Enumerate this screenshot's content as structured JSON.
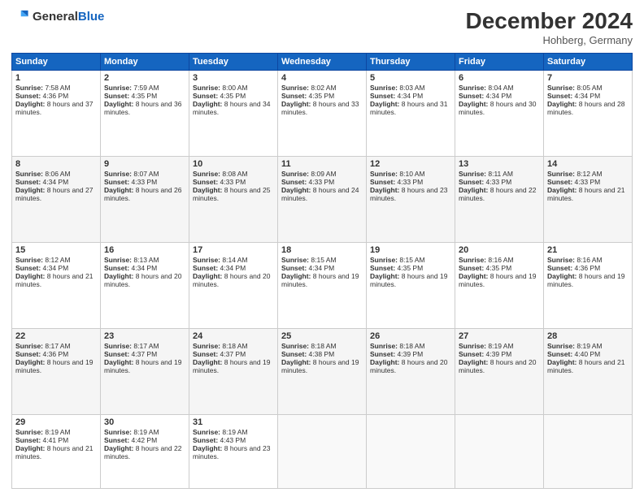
{
  "header": {
    "logo_general": "General",
    "logo_blue": "Blue",
    "title": "December 2024",
    "subtitle": "Hohberg, Germany"
  },
  "days_of_week": [
    "Sunday",
    "Monday",
    "Tuesday",
    "Wednesday",
    "Thursday",
    "Friday",
    "Saturday"
  ],
  "weeks": [
    [
      {
        "day": "1",
        "sunrise": "7:58 AM",
        "sunset": "4:36 PM",
        "daylight": "8 hours and 37 minutes."
      },
      {
        "day": "2",
        "sunrise": "7:59 AM",
        "sunset": "4:35 PM",
        "daylight": "8 hours and 36 minutes."
      },
      {
        "day": "3",
        "sunrise": "8:00 AM",
        "sunset": "4:35 PM",
        "daylight": "8 hours and 34 minutes."
      },
      {
        "day": "4",
        "sunrise": "8:02 AM",
        "sunset": "4:35 PM",
        "daylight": "8 hours and 33 minutes."
      },
      {
        "day": "5",
        "sunrise": "8:03 AM",
        "sunset": "4:34 PM",
        "daylight": "8 hours and 31 minutes."
      },
      {
        "day": "6",
        "sunrise": "8:04 AM",
        "sunset": "4:34 PM",
        "daylight": "8 hours and 30 minutes."
      },
      {
        "day": "7",
        "sunrise": "8:05 AM",
        "sunset": "4:34 PM",
        "daylight": "8 hours and 28 minutes."
      }
    ],
    [
      {
        "day": "8",
        "sunrise": "8:06 AM",
        "sunset": "4:34 PM",
        "daylight": "8 hours and 27 minutes."
      },
      {
        "day": "9",
        "sunrise": "8:07 AM",
        "sunset": "4:33 PM",
        "daylight": "8 hours and 26 minutes."
      },
      {
        "day": "10",
        "sunrise": "8:08 AM",
        "sunset": "4:33 PM",
        "daylight": "8 hours and 25 minutes."
      },
      {
        "day": "11",
        "sunrise": "8:09 AM",
        "sunset": "4:33 PM",
        "daylight": "8 hours and 24 minutes."
      },
      {
        "day": "12",
        "sunrise": "8:10 AM",
        "sunset": "4:33 PM",
        "daylight": "8 hours and 23 minutes."
      },
      {
        "day": "13",
        "sunrise": "8:11 AM",
        "sunset": "4:33 PM",
        "daylight": "8 hours and 22 minutes."
      },
      {
        "day": "14",
        "sunrise": "8:12 AM",
        "sunset": "4:33 PM",
        "daylight": "8 hours and 21 minutes."
      }
    ],
    [
      {
        "day": "15",
        "sunrise": "8:12 AM",
        "sunset": "4:34 PM",
        "daylight": "8 hours and 21 minutes."
      },
      {
        "day": "16",
        "sunrise": "8:13 AM",
        "sunset": "4:34 PM",
        "daylight": "8 hours and 20 minutes."
      },
      {
        "day": "17",
        "sunrise": "8:14 AM",
        "sunset": "4:34 PM",
        "daylight": "8 hours and 20 minutes."
      },
      {
        "day": "18",
        "sunrise": "8:15 AM",
        "sunset": "4:34 PM",
        "daylight": "8 hours and 19 minutes."
      },
      {
        "day": "19",
        "sunrise": "8:15 AM",
        "sunset": "4:35 PM",
        "daylight": "8 hours and 19 minutes."
      },
      {
        "day": "20",
        "sunrise": "8:16 AM",
        "sunset": "4:35 PM",
        "daylight": "8 hours and 19 minutes."
      },
      {
        "day": "21",
        "sunrise": "8:16 AM",
        "sunset": "4:36 PM",
        "daylight": "8 hours and 19 minutes."
      }
    ],
    [
      {
        "day": "22",
        "sunrise": "8:17 AM",
        "sunset": "4:36 PM",
        "daylight": "8 hours and 19 minutes."
      },
      {
        "day": "23",
        "sunrise": "8:17 AM",
        "sunset": "4:37 PM",
        "daylight": "8 hours and 19 minutes."
      },
      {
        "day": "24",
        "sunrise": "8:18 AM",
        "sunset": "4:37 PM",
        "daylight": "8 hours and 19 minutes."
      },
      {
        "day": "25",
        "sunrise": "8:18 AM",
        "sunset": "4:38 PM",
        "daylight": "8 hours and 19 minutes."
      },
      {
        "day": "26",
        "sunrise": "8:18 AM",
        "sunset": "4:39 PM",
        "daylight": "8 hours and 20 minutes."
      },
      {
        "day": "27",
        "sunrise": "8:19 AM",
        "sunset": "4:39 PM",
        "daylight": "8 hours and 20 minutes."
      },
      {
        "day": "28",
        "sunrise": "8:19 AM",
        "sunset": "4:40 PM",
        "daylight": "8 hours and 21 minutes."
      }
    ],
    [
      {
        "day": "29",
        "sunrise": "8:19 AM",
        "sunset": "4:41 PM",
        "daylight": "8 hours and 21 minutes."
      },
      {
        "day": "30",
        "sunrise": "8:19 AM",
        "sunset": "4:42 PM",
        "daylight": "8 hours and 22 minutes."
      },
      {
        "day": "31",
        "sunrise": "8:19 AM",
        "sunset": "4:43 PM",
        "daylight": "8 hours and 23 minutes."
      },
      null,
      null,
      null,
      null
    ]
  ],
  "labels": {
    "sunrise": "Sunrise:",
    "sunset": "Sunset:",
    "daylight": "Daylight:"
  }
}
